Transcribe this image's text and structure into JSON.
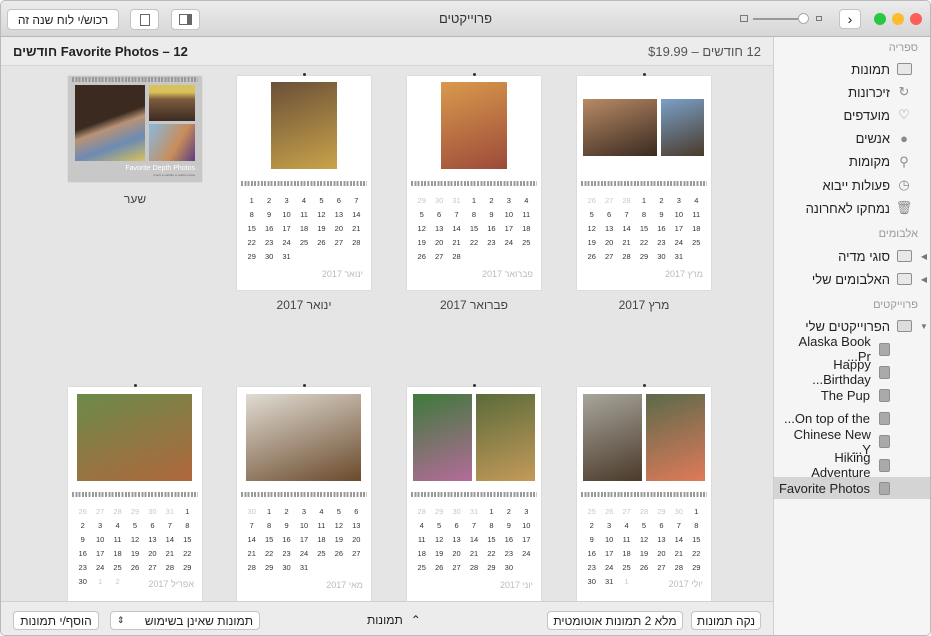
{
  "window": {
    "title": "פרוייקטים",
    "buy_button": "רכוש/י לוח שנה זה",
    "colors": {
      "close": "#fc5f57",
      "minimize": "#fdbc2e",
      "zoom": "#28c840"
    }
  },
  "header": {
    "project_title": "Favorite Photos – 12 חודשים",
    "price": "12 חודשים – $19.99"
  },
  "sidebar": {
    "library": {
      "label": "ספריה",
      "items": [
        {
          "label": "תמונות",
          "icon": "photos-icon"
        },
        {
          "label": "זיכרונות",
          "icon": "memories-icon"
        },
        {
          "label": "מועדפים",
          "icon": "heart-icon"
        },
        {
          "label": "אנשים",
          "icon": "person-icon"
        },
        {
          "label": "מקומות",
          "icon": "pin-icon"
        },
        {
          "label": "פעולות ייבוא",
          "icon": "clock-icon"
        },
        {
          "label": "נמחקו לאחרונה",
          "icon": "trash-icon"
        }
      ]
    },
    "albums": {
      "label": "אלבומים",
      "items": [
        {
          "label": "סוגי מדיה"
        },
        {
          "label": "האלבומים שלי"
        }
      ]
    },
    "projects": {
      "label": "פרוייקטים",
      "folder": "הפרוייקטים שלי",
      "items": [
        {
          "label": "Alaska Book Pr..."
        },
        {
          "label": "Happy Birthday..."
        },
        {
          "label": "The Pup"
        },
        {
          "label": "On top of the..."
        },
        {
          "label": "Chinese New Y..."
        },
        {
          "label": "Hiking Adventure"
        },
        {
          "label": "Favorite Photos",
          "selected": true
        }
      ]
    }
  },
  "cover": {
    "caption": "שער",
    "title": "Favorite Depth Photos",
    "subtitle": "Insert a subtitle or author name"
  },
  "months": [
    {
      "caption": "ינואר 2017",
      "label": "ינואר 2017",
      "month": 1,
      "year": 2017
    },
    {
      "caption": "פברואר 2017",
      "label": "פברואר 2017",
      "month": 2,
      "year": 2017
    },
    {
      "caption": "מרץ 2017",
      "label": "מרץ 2017",
      "month": 3,
      "year": 2017
    },
    {
      "caption": "",
      "label": "אפריל 2017",
      "month": 4,
      "year": 2017
    },
    {
      "caption": "",
      "label": "מאי 2017",
      "month": 5,
      "year": 2017
    },
    {
      "caption": "",
      "label": "יוני 2017",
      "month": 6,
      "year": 2017
    },
    {
      "caption": "",
      "label": "יולי 2017",
      "month": 7,
      "year": 2017
    }
  ],
  "bottombar": {
    "clear": "נקה תמונות",
    "autofill": "מלא 2 תמונות אוטומטית",
    "photos_toggle": "תמונות",
    "filter": "תמונות שאינן בשימוש",
    "add": "הוסף/י תמונות"
  }
}
